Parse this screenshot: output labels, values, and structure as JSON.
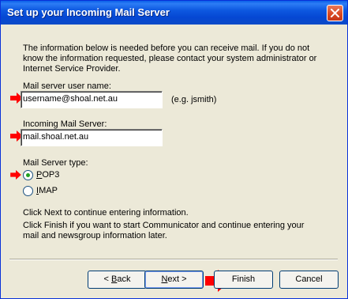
{
  "window": {
    "title": "Set up your Incoming Mail Server",
    "close_icon": "close-icon"
  },
  "info": {
    "text": "The information below is needed before you can receive mail.  If you do not know the information requested, please contact your system administrator or Internet Service Provider."
  },
  "fields": {
    "username_label": "Mail server user name:",
    "username_value": "username@shoal.net.au",
    "username_hint": "(e.g. jsmith)",
    "server_label": "Incoming Mail Server:",
    "server_value": "mail.shoal.net.au",
    "type_label": "Mail Server type:"
  },
  "server_type": {
    "options": [
      {
        "label_first": "P",
        "label_rest": "OP3",
        "selected": true
      },
      {
        "label_first": "I",
        "label_rest": "MAP",
        "selected": false
      }
    ]
  },
  "instructions": {
    "next_text": "Click Next to continue entering information.",
    "finish_text": "Click Finish if you want to start Communicator and continue entering your mail and newsgroup information later."
  },
  "buttons": {
    "back_prefix": "< ",
    "back_hot": "B",
    "back_rest": "ack",
    "next_hot": "N",
    "next_rest": "ext >",
    "finish": "Finish",
    "cancel": "Cancel"
  },
  "colors": {
    "pointer_arrow": "#ff0000",
    "titlebar": "#0a5fe8",
    "dialog_bg": "#ece9d8"
  },
  "icons": {
    "arrows": "right-arrow-pointer-icon"
  }
}
